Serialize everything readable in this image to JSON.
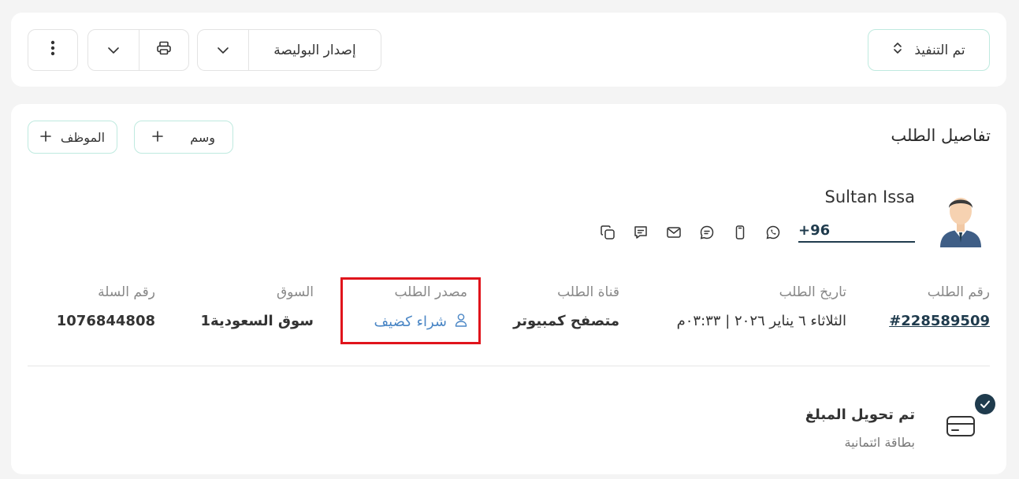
{
  "toolbar": {
    "status_label": "تم التنفيذ",
    "issue_policy_label": "إصدار البوليصة"
  },
  "details": {
    "title": "تفاصيل الطلب",
    "tag_label": "وسم",
    "employee_label": "الموظف"
  },
  "customer": {
    "name": "Sultan Issa",
    "phone": "+96"
  },
  "order": {
    "number_label": "رقم الطلب",
    "number_value": "#228589509",
    "date_label": "تاريخ الطلب",
    "date_value": "الثلاثاء ٦ يناير ٢٠٢٦ | ٠٣:٣٣م",
    "channel_label": "قناة الطلب",
    "channel_value": "متصفح كمبيوتر",
    "source_label": "مصدر الطلب",
    "source_value": "شراء كضيف",
    "market_label": "السوق",
    "market_value": "سوق السعودية1",
    "cart_label": "رقم السلة",
    "cart_value": "1076844808"
  },
  "payment": {
    "title": "تم تحويل المبلغ",
    "method": "بطاقة ائتمانية"
  },
  "colors": {
    "accent_dark": "#1f3b4d",
    "link_blue": "#4a86c5",
    "mint_border": "#bfeadf",
    "highlight_red": "#e0141c"
  }
}
